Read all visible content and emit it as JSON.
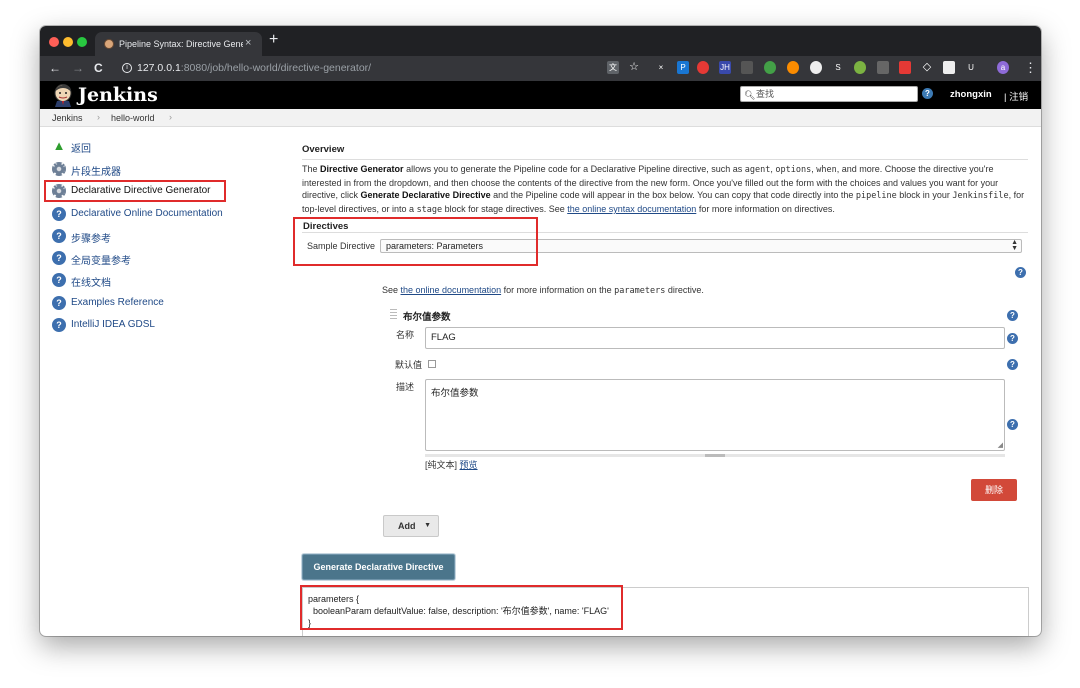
{
  "browser": {
    "tab_title": "Pipeline Syntax: Directive Generator",
    "url_host": "127.0.0.1",
    "url_path": ":8080/job/hello-world/directive-generator/"
  },
  "header": {
    "logo_text": "Jenkins",
    "search_placeholder": "查找",
    "username": "zhongxin",
    "logout": "| 注销"
  },
  "breadcrumb": {
    "items": [
      "Jenkins",
      "hello-world"
    ]
  },
  "sidebar": {
    "items": [
      {
        "label": "返回",
        "icon": "up-arrow-icon"
      },
      {
        "label": "片段生成器",
        "icon": "gear-icon"
      },
      {
        "label": "Declarative Directive Generator",
        "icon": "gear-icon"
      },
      {
        "label": "Declarative Online Documentation",
        "icon": "help-icon"
      },
      {
        "label": "步骤参考",
        "icon": "help-icon"
      },
      {
        "label": "全局变量参考",
        "icon": "help-icon"
      },
      {
        "label": "在线文档",
        "icon": "help-icon"
      },
      {
        "label": "Examples Reference",
        "icon": "help-icon"
      },
      {
        "label": "IntelliJ IDEA GDSL",
        "icon": "help-icon"
      }
    ]
  },
  "overview": {
    "title": "Overview",
    "p_the": "The ",
    "p_dg": "Directive Generator",
    "p_1": " allows you to generate the Pipeline code for a Declarative Pipeline directive, such as ",
    "c_agent": "agent",
    "p_comma1": ", ",
    "c_options": "options",
    "p_comma2": ", ",
    "c_when": "when",
    "p_2": ", and more. Choose the directive you're interested in from the dropdown, and then choose the contents of the directive from the new form. Once you've filled out the form with the choices and values you want for your directive, click ",
    "p_gdd": "Generate Declarative Directive",
    "p_3": " and the Pipeline code will appear in the box below. You can copy that code directly into the ",
    "c_pipeline": "pipeline",
    "p_4": " block in your ",
    "c_jenkinsfile": "Jenkinsfile",
    "p_5": ", for top-level directives, or into a ",
    "c_stage": "stage",
    "p_6": " block for stage directives. See ",
    "link": "the online syntax documentation",
    "p_7": " for more information on directives."
  },
  "directives": {
    "title": "Directives",
    "sample_label": "Sample Directive",
    "selected": "parameters: Parameters",
    "see_prefix": "See ",
    "see_link": "the online documentation",
    "see_mid": " for more information on the ",
    "see_code": "parameters",
    "see_suffix": " directive."
  },
  "parameter": {
    "title": "布尔值参数",
    "name_label": "名称",
    "name_value": "FLAG",
    "default_label": "默认值",
    "desc_label": "描述",
    "desc_value": "布尔值参数",
    "plain_text": "[纯文本]",
    "preview": "预览",
    "delete": "删除"
  },
  "actions": {
    "add": "Add",
    "generate": "Generate Declarative Directive"
  },
  "output": {
    "code": "parameters {\n  booleanParam defaultValue: false, description: '布尔值参数', name: 'FLAG'\n}"
  },
  "colors": {
    "highlight": "#e02b2b",
    "link": "#204a87",
    "generate_button": "#4b758b",
    "delete_button": "#d24939"
  }
}
